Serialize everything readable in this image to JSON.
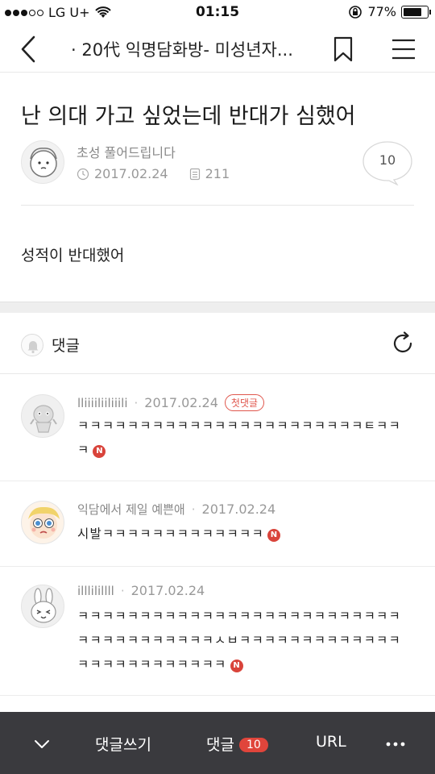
{
  "status_bar": {
    "carrier": "LG U+",
    "time": "01:15",
    "battery": "77%",
    "battery_level": 0.77,
    "signal_bars_filled": 3,
    "signal_bars_total": 5
  },
  "nav": {
    "title": "· 20代 익명담화방- 미성년자..."
  },
  "post": {
    "title": "난 의대 가고 싶었는데 반대가 심했어",
    "author": "초성 풀어드립니다",
    "date": "2017.02.24",
    "views": "211",
    "comment_count": "10",
    "body": "성적이 반대했어"
  },
  "comments_section": {
    "label": "댓글"
  },
  "comments": [
    {
      "author": "lliiiiliiliiili",
      "date": "2017.02.24",
      "badge": "첫댓글",
      "text": "ㅋㅋㅋㅋㅋㅋㅋㅋㅋㅋㅋㅋㅋㅋㅋㅋㅋㅋㅋㅋㅋㅋㅋㅌㅋㅋㅋ",
      "new_badge": "N"
    },
    {
      "author": "익담에서 제일 예쁜애",
      "date": "2017.02.24",
      "text": "시발ㅋㅋㅋㅋㅋㅋㅋㅋㅋㅋㅋㅋㅋ",
      "new_badge": "N"
    },
    {
      "author": "illlilillll",
      "date": "2017.02.24",
      "text": "ㅋㅋㅋㅋㅋㅋㅋㅋㅋㅋㅋㅋㅋㅋㅋㅋㅋㅋㅋㅋㅋㅋㅋㅋㅋㅋㅋㅋㅋㅋㅋㅋㅋㅋㅋㅋㅋㅅㅂㅋㅋㅋㅋㅋㅋㅋㅋㅋㅋㅋㅋㅋㅋㅋㅋㅋㅋㅋㅋㅋㅋㅋㅋㅋ",
      "new_badge": "N"
    }
  ],
  "bottom_bar": {
    "write_comment": "댓글쓰기",
    "comments_label": "댓글",
    "comments_count": "10",
    "url": "URL"
  },
  "colors": {
    "accent": "#e0453b",
    "bottom_bar_bg": "#3a3a3e"
  }
}
